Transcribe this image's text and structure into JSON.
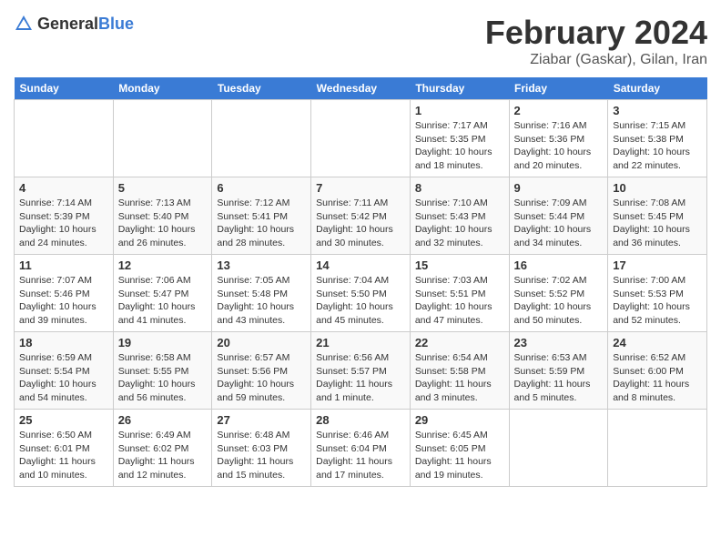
{
  "header": {
    "logo_general": "General",
    "logo_blue": "Blue",
    "month_title": "February 2024",
    "location": "Ziabar (Gaskar), Gilan, Iran"
  },
  "weekdays": [
    "Sunday",
    "Monday",
    "Tuesday",
    "Wednesday",
    "Thursday",
    "Friday",
    "Saturday"
  ],
  "weeks": [
    [
      {
        "day": "",
        "info": ""
      },
      {
        "day": "",
        "info": ""
      },
      {
        "day": "",
        "info": ""
      },
      {
        "day": "",
        "info": ""
      },
      {
        "day": "1",
        "info": "Sunrise: 7:17 AM\nSunset: 5:35 PM\nDaylight: 10 hours\nand 18 minutes."
      },
      {
        "day": "2",
        "info": "Sunrise: 7:16 AM\nSunset: 5:36 PM\nDaylight: 10 hours\nand 20 minutes."
      },
      {
        "day": "3",
        "info": "Sunrise: 7:15 AM\nSunset: 5:38 PM\nDaylight: 10 hours\nand 22 minutes."
      }
    ],
    [
      {
        "day": "4",
        "info": "Sunrise: 7:14 AM\nSunset: 5:39 PM\nDaylight: 10 hours\nand 24 minutes."
      },
      {
        "day": "5",
        "info": "Sunrise: 7:13 AM\nSunset: 5:40 PM\nDaylight: 10 hours\nand 26 minutes."
      },
      {
        "day": "6",
        "info": "Sunrise: 7:12 AM\nSunset: 5:41 PM\nDaylight: 10 hours\nand 28 minutes."
      },
      {
        "day": "7",
        "info": "Sunrise: 7:11 AM\nSunset: 5:42 PM\nDaylight: 10 hours\nand 30 minutes."
      },
      {
        "day": "8",
        "info": "Sunrise: 7:10 AM\nSunset: 5:43 PM\nDaylight: 10 hours\nand 32 minutes."
      },
      {
        "day": "9",
        "info": "Sunrise: 7:09 AM\nSunset: 5:44 PM\nDaylight: 10 hours\nand 34 minutes."
      },
      {
        "day": "10",
        "info": "Sunrise: 7:08 AM\nSunset: 5:45 PM\nDaylight: 10 hours\nand 36 minutes."
      }
    ],
    [
      {
        "day": "11",
        "info": "Sunrise: 7:07 AM\nSunset: 5:46 PM\nDaylight: 10 hours\nand 39 minutes."
      },
      {
        "day": "12",
        "info": "Sunrise: 7:06 AM\nSunset: 5:47 PM\nDaylight: 10 hours\nand 41 minutes."
      },
      {
        "day": "13",
        "info": "Sunrise: 7:05 AM\nSunset: 5:48 PM\nDaylight: 10 hours\nand 43 minutes."
      },
      {
        "day": "14",
        "info": "Sunrise: 7:04 AM\nSunset: 5:50 PM\nDaylight: 10 hours\nand 45 minutes."
      },
      {
        "day": "15",
        "info": "Sunrise: 7:03 AM\nSunset: 5:51 PM\nDaylight: 10 hours\nand 47 minutes."
      },
      {
        "day": "16",
        "info": "Sunrise: 7:02 AM\nSunset: 5:52 PM\nDaylight: 10 hours\nand 50 minutes."
      },
      {
        "day": "17",
        "info": "Sunrise: 7:00 AM\nSunset: 5:53 PM\nDaylight: 10 hours\nand 52 minutes."
      }
    ],
    [
      {
        "day": "18",
        "info": "Sunrise: 6:59 AM\nSunset: 5:54 PM\nDaylight: 10 hours\nand 54 minutes."
      },
      {
        "day": "19",
        "info": "Sunrise: 6:58 AM\nSunset: 5:55 PM\nDaylight: 10 hours\nand 56 minutes."
      },
      {
        "day": "20",
        "info": "Sunrise: 6:57 AM\nSunset: 5:56 PM\nDaylight: 10 hours\nand 59 minutes."
      },
      {
        "day": "21",
        "info": "Sunrise: 6:56 AM\nSunset: 5:57 PM\nDaylight: 11 hours\nand 1 minute."
      },
      {
        "day": "22",
        "info": "Sunrise: 6:54 AM\nSunset: 5:58 PM\nDaylight: 11 hours\nand 3 minutes."
      },
      {
        "day": "23",
        "info": "Sunrise: 6:53 AM\nSunset: 5:59 PM\nDaylight: 11 hours\nand 5 minutes."
      },
      {
        "day": "24",
        "info": "Sunrise: 6:52 AM\nSunset: 6:00 PM\nDaylight: 11 hours\nand 8 minutes."
      }
    ],
    [
      {
        "day": "25",
        "info": "Sunrise: 6:50 AM\nSunset: 6:01 PM\nDaylight: 11 hours\nand 10 minutes."
      },
      {
        "day": "26",
        "info": "Sunrise: 6:49 AM\nSunset: 6:02 PM\nDaylight: 11 hours\nand 12 minutes."
      },
      {
        "day": "27",
        "info": "Sunrise: 6:48 AM\nSunset: 6:03 PM\nDaylight: 11 hours\nand 15 minutes."
      },
      {
        "day": "28",
        "info": "Sunrise: 6:46 AM\nSunset: 6:04 PM\nDaylight: 11 hours\nand 17 minutes."
      },
      {
        "day": "29",
        "info": "Sunrise: 6:45 AM\nSunset: 6:05 PM\nDaylight: 11 hours\nand 19 minutes."
      },
      {
        "day": "",
        "info": ""
      },
      {
        "day": "",
        "info": ""
      }
    ]
  ]
}
